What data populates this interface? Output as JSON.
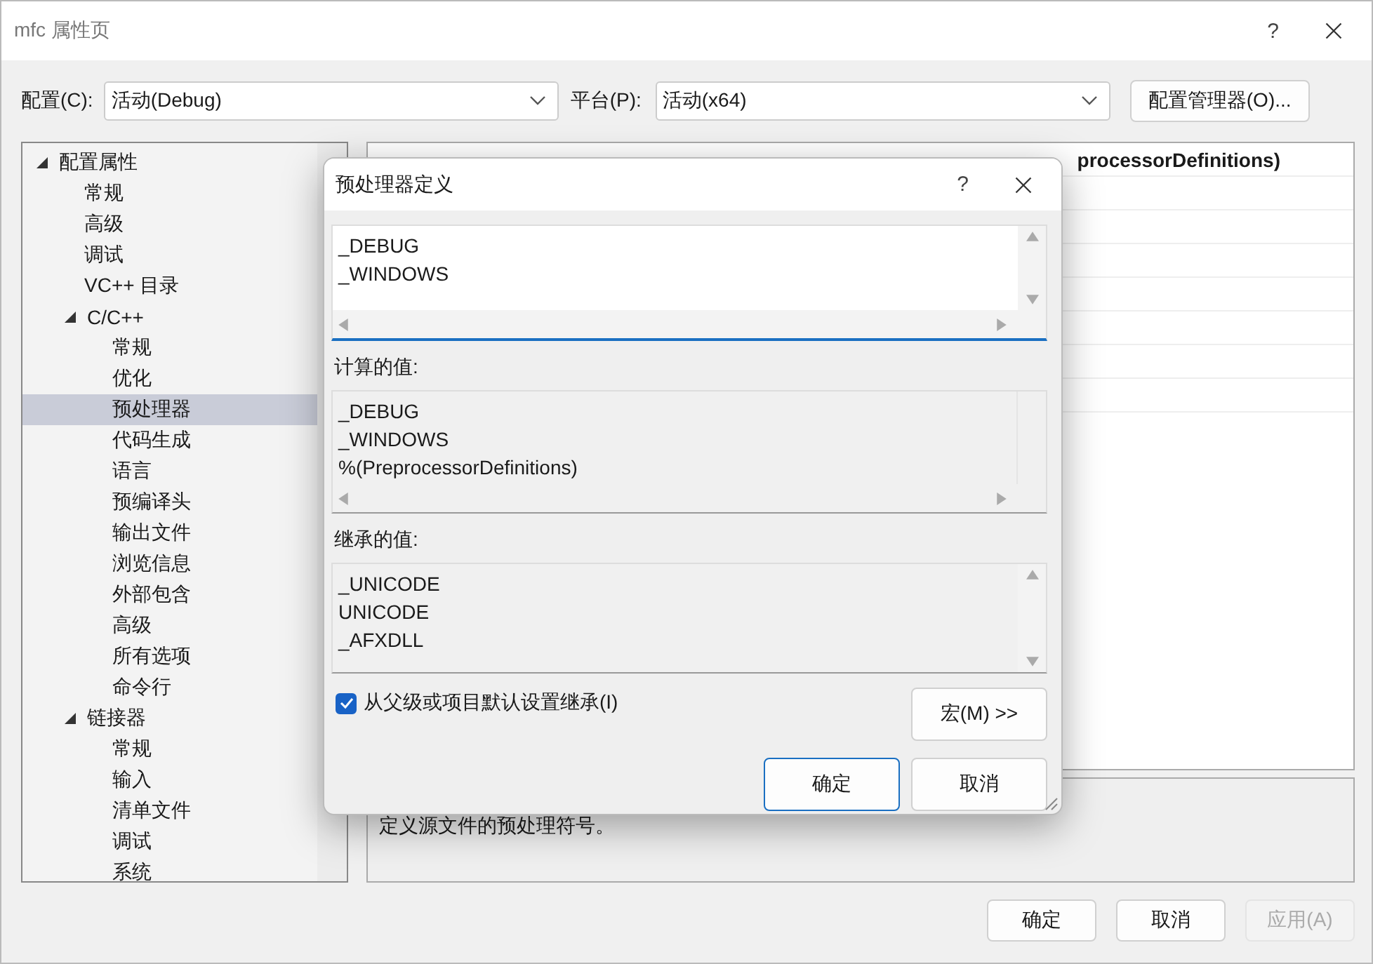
{
  "window": {
    "title": "mfc 属性页",
    "help": "?"
  },
  "config": {
    "label": "配置(C):",
    "value": "活动(Debug)",
    "platform_label": "平台(P):",
    "platform_value": "活动(x64)",
    "manager_button": "配置管理器(O)..."
  },
  "tree": {
    "items": [
      {
        "label": "配置属性",
        "expanded": true,
        "selected": false,
        "children": [
          {
            "label": "常规",
            "selected": false
          },
          {
            "label": "高级",
            "selected": false
          },
          {
            "label": "调试",
            "selected": false
          },
          {
            "label": "VC++ 目录",
            "selected": false
          },
          {
            "label": "C/C++",
            "expanded": true,
            "selected": false,
            "children": [
              {
                "label": "常规",
                "selected": false
              },
              {
                "label": "优化",
                "selected": false
              },
              {
                "label": "预处理器",
                "selected": true
              },
              {
                "label": "代码生成",
                "selected": false
              },
              {
                "label": "语言",
                "selected": false
              },
              {
                "label": "预编译头",
                "selected": false
              },
              {
                "label": "输出文件",
                "selected": false
              },
              {
                "label": "浏览信息",
                "selected": false
              },
              {
                "label": "外部包含",
                "selected": false
              },
              {
                "label": "高级",
                "selected": false
              },
              {
                "label": "所有选项",
                "selected": false
              },
              {
                "label": "命令行",
                "selected": false
              }
            ]
          },
          {
            "label": "链接器",
            "expanded": true,
            "selected": false,
            "children": [
              {
                "label": "常规",
                "selected": false
              },
              {
                "label": "输入",
                "selected": false
              },
              {
                "label": "清单文件",
                "selected": false
              },
              {
                "label": "调试",
                "selected": false
              },
              {
                "label": "系统",
                "selected": false
              }
            ]
          }
        ]
      }
    ]
  },
  "grid": {
    "visible_value": "processorDefinitions)"
  },
  "description": "定义源文件的预处理符号。",
  "buttons": [
    {
      "label": "确定",
      "disabled": false
    },
    {
      "label": "取消",
      "disabled": false
    },
    {
      "label": "应用(A)",
      "disabled": true
    }
  ],
  "dialog": {
    "title": "预处理器定义",
    "help": "?",
    "definitions": [
      "_DEBUG",
      "_WINDOWS"
    ],
    "computed_label": "计算的值:",
    "computed_lines": [
      "_DEBUG",
      "_WINDOWS",
      "%(PreprocessorDefinitions)"
    ],
    "inherited_label": "继承的值:",
    "inherited_lines": [
      "_UNICODE",
      "UNICODE",
      "_AFXDLL"
    ],
    "inherit_checkbox": {
      "label": "从父级或项目默认设置继承(I)",
      "checked": true
    },
    "macro_button": "宏(M) >>",
    "buttons": [
      {
        "label": "确定",
        "default": true
      },
      {
        "label": "取消",
        "default": false
      }
    ]
  }
}
